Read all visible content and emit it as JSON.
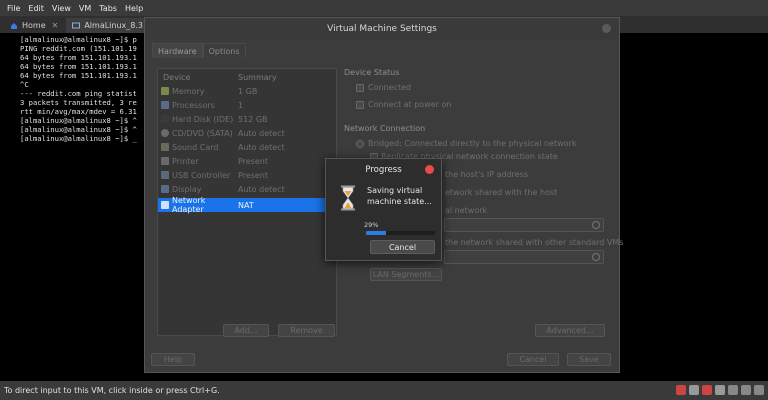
{
  "menubar": {
    "items": [
      "File",
      "Edit",
      "View",
      "VM",
      "Tabs",
      "Help"
    ]
  },
  "tabs": [
    {
      "label": "Home",
      "active": false
    },
    {
      "label": "AlmaLinux_8.3",
      "active": true
    }
  ],
  "terminal": {
    "lines": [
      "[almalinux@almalinux8 ~]$ p",
      "PING reddit.com (151.101.19",
      "64 bytes from 151.101.193.1",
      "64 bytes from 151.101.193.1",
      "64 bytes from 151.101.193.1",
      "^C",
      "--- reddit.com ping statist",
      "3 packets transmitted, 3 re",
      "rtt min/avg/max/mdev = 6.31",
      "[almalinux@almalinux8 ~]$ ^",
      "[almalinux@almalinux8 ~]$ ^",
      "[almalinux@almalinux8 ~]$ _"
    ]
  },
  "statusbar": {
    "text": "To direct input to this VM, click inside or press Ctrl+G."
  },
  "settings": {
    "title": "Virtual Machine Settings",
    "tabs": [
      "Hardware",
      "Options"
    ],
    "device_header": "Device",
    "summary_header": "Summary",
    "devices": [
      {
        "name": "Memory",
        "summary": "1 GB",
        "color": "#7a8a4a"
      },
      {
        "name": "Processors",
        "summary": "1",
        "color": "#5a6a8a"
      },
      {
        "name": "Hard Disk (IDE)",
        "summary": "512 GB",
        "color": "#3a3a3a"
      },
      {
        "name": "CD/DVD (SATA)",
        "summary": "Auto detect",
        "color": "#6a6a6a"
      },
      {
        "name": "Sound Card",
        "summary": "Auto detect",
        "color": "#6a6a5a"
      },
      {
        "name": "Printer",
        "summary": "Present",
        "color": "#6a6a6a"
      },
      {
        "name": "USB Controller",
        "summary": "Present",
        "color": "#5a6a7a"
      },
      {
        "name": "Display",
        "summary": "Auto detect",
        "color": "#5a6a8a"
      },
      {
        "name": "Network Adapter",
        "summary": "NAT",
        "color": "#cfe0ff"
      }
    ],
    "add_label": "Add...",
    "remove_label": "Remove",
    "device_status": "Device Status",
    "connected": "Connected",
    "connect_at_power_on": "Connect at power on",
    "network_connection": "Network Connection",
    "bridged": "Bridged: Connected directly to the physical network",
    "replicate": "Replicate physical network connection state",
    "host_ip": "the host's IP address",
    "shared_host": "etwork shared with the host",
    "network_label": "al network",
    "custom_vm": "the network shared with other standard VMs",
    "lan_segments": "LAN Segments...",
    "advanced": "Advanced...",
    "help": "Help",
    "cancel": "Cancel",
    "save": "Save"
  },
  "progress": {
    "title": "Progress",
    "message": "Saving virtual machine state...",
    "percent_label": "29%",
    "percent": 0.29,
    "cancel": "Cancel"
  }
}
